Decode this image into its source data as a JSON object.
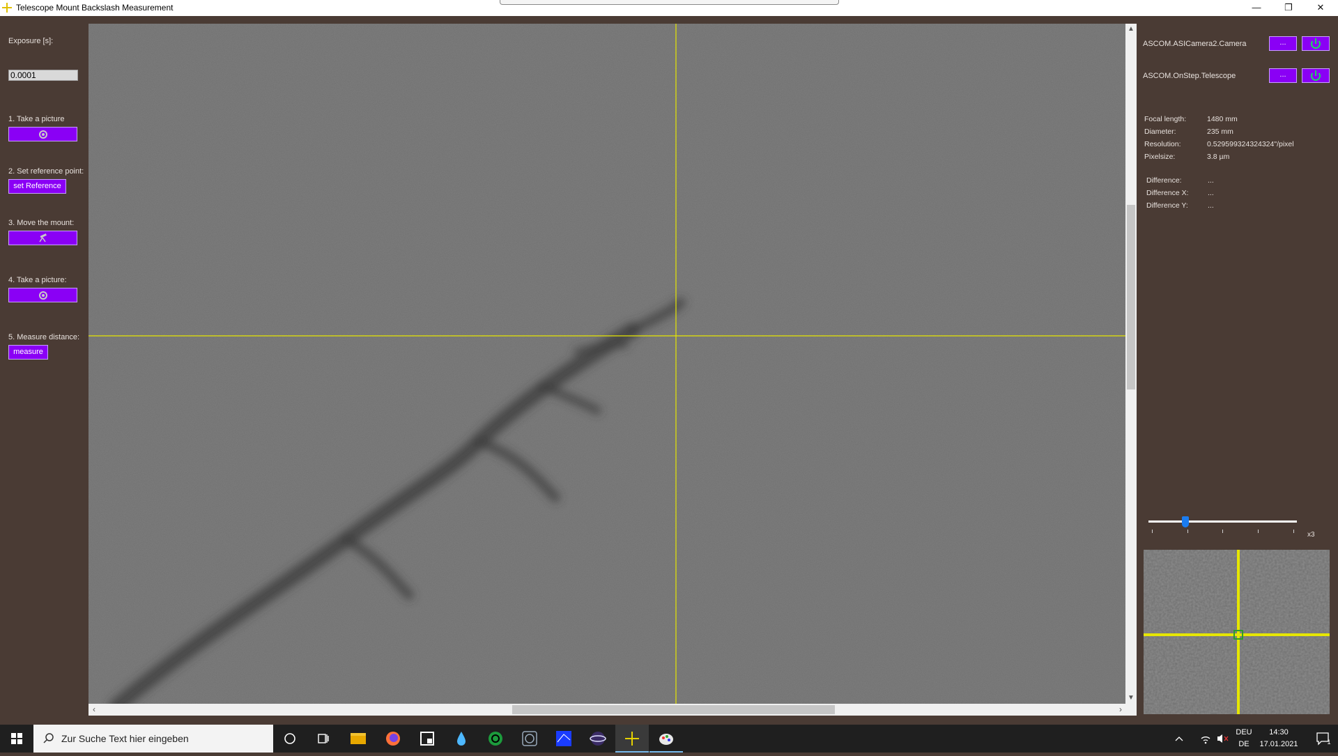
{
  "window": {
    "title": "Telescope Mount Backslash Measurement",
    "minimize_glyph": "—",
    "maximize_glyph": "❐",
    "close_glyph": "✕"
  },
  "left_panel": {
    "exposure_label": "Exposure [s]:",
    "exposure_value": "0.0001",
    "steps": [
      {
        "label": "1. Take a picture",
        "button_icon": "refresh-icon"
      },
      {
        "label": "2. Set reference point:",
        "button_label": "set Reference"
      },
      {
        "label": "3. Move the mount:",
        "button_icon": "telescope-icon"
      },
      {
        "label": "4. Take a picture:",
        "button_icon": "refresh-icon"
      },
      {
        "label": "5. Measure distance:",
        "button_label": "measure"
      }
    ]
  },
  "right_panel": {
    "devices": [
      {
        "name": "ASCOM.ASICamera2.Camera",
        "choose_label": "...",
        "power_icon": "power-icon"
      },
      {
        "name": "ASCOM.OnStep.Telescope",
        "choose_label": "...",
        "power_icon": "power-icon"
      }
    ],
    "info": [
      {
        "label": "Focal length:",
        "value": "1480 mm"
      },
      {
        "label": "Diameter:",
        "value": "235 mm"
      },
      {
        "label": "Resolution:",
        "value": "0.529599324324324\"/pixel"
      },
      {
        "label": "Pixelsize:",
        "value": "3.8 µm"
      }
    ],
    "differences": [
      {
        "label": "Difference:",
        "value": "..."
      },
      {
        "label": "Difference X:",
        "value": "..."
      },
      {
        "label": "Difference Y:",
        "value": "..."
      }
    ],
    "zoom": {
      "label": "x3",
      "slider_fraction": 0.25
    }
  },
  "colors": {
    "accent": "#8a00f5",
    "crosshair": "#e6e600",
    "background": "#4a3b34"
  },
  "taskbar": {
    "search_placeholder": "Zur Suche Text hier eingeben",
    "language_top": "DEU",
    "language_bottom": "DE",
    "time": "14:30",
    "date": "17.01.2021",
    "notification_count": "1"
  }
}
